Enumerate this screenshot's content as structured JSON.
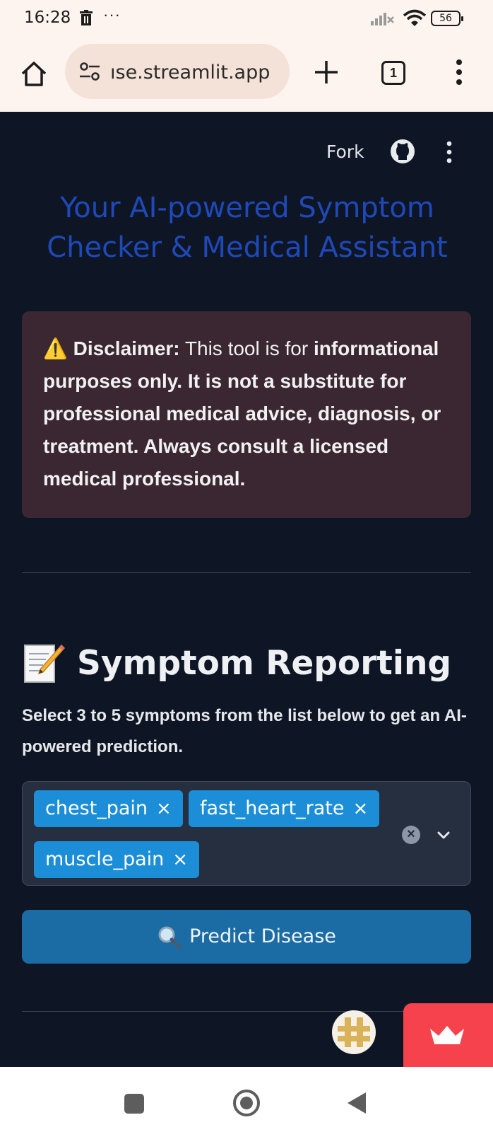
{
  "status_bar": {
    "time": "16:28",
    "more_indicator": "···",
    "battery_level": "56"
  },
  "browser": {
    "url": "ıse.streamlit.app",
    "tab_count": "1"
  },
  "app_header": {
    "fork_label": "Fork"
  },
  "app": {
    "title": "Your AI-powered Symptom Checker & Medical Assistant",
    "disclaimer": {
      "icon": "⚠️",
      "label": "Disclaimer:",
      "lead": "This tool is for",
      "body": "informational purposes only. It is not a substitute for professional medical advice, diagnosis, or treatment. Always consult a licensed medical professional."
    },
    "section": {
      "heading": "Symptom Reporting",
      "instructions": "Select 3 to 5 symptoms from the list below to get an AI-powered prediction."
    },
    "symptom_select": {
      "selected": [
        "chest_pain",
        "fast_heart_rate",
        "muscle_pain"
      ],
      "remove_glyph": "×"
    },
    "predict_button": "Predict Disease"
  },
  "colors": {
    "app_background": "#0e1626",
    "title": "#1f49b8",
    "disclaimer_bg": "#3b2732",
    "chip": "#1c8ed8",
    "button": "#1b6ca4",
    "fab": "#f5424c"
  },
  "icons": [
    "trash-icon",
    "signal-icon",
    "wifi-icon",
    "battery-icon",
    "home-icon",
    "site-settings-icon",
    "plus-icon",
    "tab-switcher-icon",
    "more-vert-icon",
    "github-icon",
    "memo-icon",
    "warning-icon",
    "clear-icon",
    "chevron-down-icon",
    "magnifier-icon",
    "crown-icon"
  ]
}
